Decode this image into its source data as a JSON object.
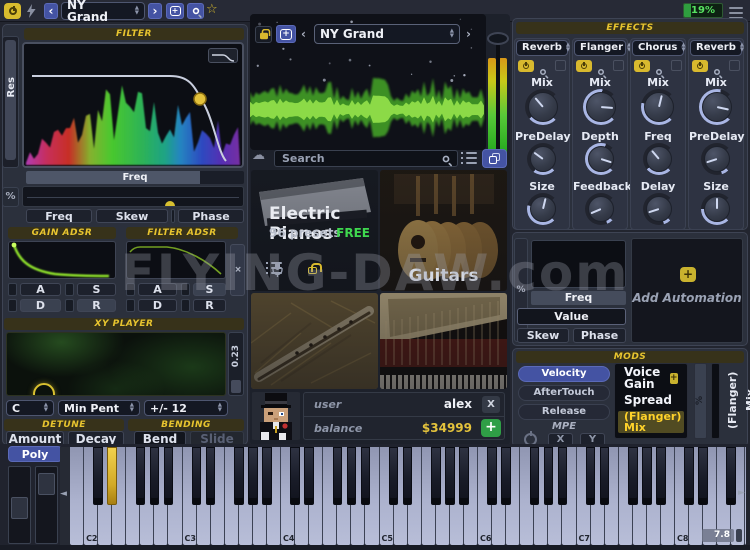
{
  "topbar": {
    "preset": "NY Grand",
    "battery": "19%"
  },
  "icons": {
    "up": "▲",
    "down": "▼",
    "back": "‹",
    "forward": "›",
    "scroll_left": "◄",
    "scroll_right": "►",
    "star": "☆",
    "cloud": "☁",
    "percent": "%",
    "plus": "+"
  },
  "filter": {
    "title": "FILTER",
    "res_label": "Res",
    "freq_label": "Freq",
    "tabs": [
      "Freq",
      "Skew",
      "Phase"
    ]
  },
  "adsr": {
    "gain_title": "GAIN ADSR",
    "filter_title": "FILTER ADSR",
    "keys": [
      "A",
      "S",
      "D",
      "R"
    ]
  },
  "xy": {
    "title": "XY PLAYER",
    "slider_value": "0.23",
    "root": "C",
    "scale": "Min Pent",
    "range": "+/- 12"
  },
  "detune": {
    "title": "DETUNE",
    "amount": "Amount",
    "decay": "Decay"
  },
  "bending": {
    "title": "BENDING",
    "bend": "Bend",
    "slide": "Slide"
  },
  "browser": {
    "preset": "NY Grand",
    "search_placeholder": "Search",
    "tiles": [
      {
        "title": "Electric Pianos",
        "count": "96 presets",
        "badge": "FREE"
      },
      {
        "title": "Guitars"
      },
      {
        "title": ""
      },
      {
        "title": ""
      }
    ],
    "user_label": "user",
    "user_value": "alex",
    "close_label": "X",
    "balance_label": "balance",
    "balance_value": "$34999"
  },
  "effects": {
    "title": "EFFECTS",
    "slots": [
      {
        "type": "Reverb",
        "knobs": [
          {
            "label": "Mix",
            "value": 0.35
          },
          {
            "label": "PreDelay",
            "value": 0.3
          },
          {
            "label": "Size",
            "value": 0.55
          }
        ]
      },
      {
        "type": "Flanger",
        "knobs": [
          {
            "label": "Mix",
            "value": 0.85
          },
          {
            "label": "Depth",
            "value": 0.9
          },
          {
            "label": "Feedback",
            "value": 0.08
          }
        ]
      },
      {
        "type": "Chorus",
        "knobs": [
          {
            "label": "Mix",
            "value": 0.55
          },
          {
            "label": "Freq",
            "value": 0.35
          },
          {
            "label": "Delay",
            "value": 0.1
          }
        ]
      },
      {
        "type": "Reverb",
        "knobs": [
          {
            "label": "Mix",
            "value": 0.88
          },
          {
            "label": "PreDelay",
            "value": 0.1
          },
          {
            "label": "Size",
            "value": 0.5
          }
        ]
      }
    ]
  },
  "automation": {
    "freq_label": "Freq",
    "value_label": "Value",
    "skew": "Skew",
    "phase": "Phase",
    "add_label": "Add Automation"
  },
  "mods": {
    "title": "MODS",
    "tabs": [
      "Velocity",
      "AfterTouch",
      "Release"
    ],
    "mpe_label": "MPE",
    "x": "X",
    "y": "Y",
    "items": [
      {
        "label": "Voice Gain"
      },
      {
        "label": "Spread"
      },
      {
        "label": "(Flanger) Mix"
      }
    ],
    "selected_item": "(Flanger) Mix",
    "routing_label": "(Flanger) Mix"
  },
  "keyboard": {
    "poly": "Poly",
    "octaves": [
      "C2",
      "C3",
      "C4",
      "C5",
      "C6",
      "C7",
      "C8"
    ],
    "highlighted_key": "D#2",
    "zoom_value": "7.8"
  },
  "watermark": "FLYING-DAW.com"
}
